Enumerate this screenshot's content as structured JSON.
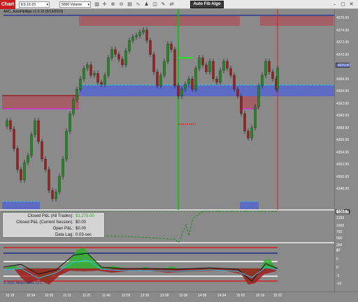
{
  "toolbar": {
    "chart_tab": "Chart",
    "instrument": "ES 12-23",
    "bar_type": "5000 Volume",
    "auto_fib_button": "Auto Fib Algo",
    "icons": [
      "bar-chart-icon",
      "crosshair-icon",
      "zoom-in-icon",
      "zoom-out-icon",
      "properties-icon",
      "indicators-icon",
      "strategies-icon",
      "drawing-tools-icon",
      "pencil-icon",
      "chart-trader-icon"
    ]
  },
  "indicator_title": "ARC_AutoFibAlgo v1.0.10 (9/13/2023)",
  "price_axis": {
    "labels": [
      "4376.00",
      "4374.00",
      "4372.00",
      "4370.00",
      "4368.00",
      "4366.00",
      "4364.00",
      "4362.00",
      "4360.00",
      "4358.00",
      "4356.00",
      "4354.00",
      "4352.00",
      "4350.00",
      "4348.00"
    ],
    "current_price": "4370.00",
    "zone_tag": "4366.75"
  },
  "pnl": {
    "rows": [
      {
        "label": "Closed P&L (All Trades):",
        "value": "$1,275.00",
        "highlight": true
      },
      {
        "label": "Closed P&L (Current Session):",
        "value": "$0.00",
        "highlight": false
      },
      {
        "label": "Open P&L:",
        "value": "$0.00",
        "highlight": false
      },
      {
        "label": "Data Lag:",
        "value": "0.03-sec",
        "highlight": false
      }
    ]
  },
  "pnl_axis": {
    "labels": [
      "1275",
      "1250",
      "1000",
      "750",
      "500",
      "250",
      "0"
    ]
  },
  "oscillator_axis": {
    "labels": [
      "10",
      "5",
      "0",
      "-5",
      "-10"
    ]
  },
  "time_axis": {
    "labels": [
      "10:18",
      "10:34",
      "10:55",
      "11:11",
      "11:21",
      "11:40",
      "12:03",
      "12:36",
      "13:08",
      "13:36",
      "14:08",
      "14:34",
      "15:02",
      "15:16",
      "15:32"
    ]
  },
  "copyright": "© 2023 NinjaTrader, LLC",
  "colors": {
    "background": "#8a8a8a",
    "up_candle": "#1f8a1f",
    "down_candle": "#a01e1e",
    "supply_zone": "#a45e66",
    "demand_zone": "#5d6bc4",
    "cyan_line": "#27c6e6",
    "magenta_line": "#e020e0",
    "vertical_green": "#22b422",
    "vertical_red": "#d82020",
    "accent_chart_tab": "#c81d1d"
  }
}
